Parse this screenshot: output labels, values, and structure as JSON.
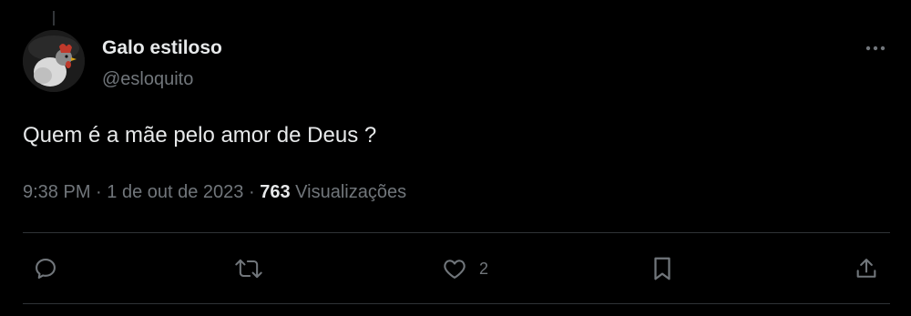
{
  "user": {
    "display_name": "Galo estiloso",
    "handle": "@esloquito",
    "avatar_icon": "rooster-avatar"
  },
  "tweet": {
    "text": "Quem é a mãe pelo amor de Deus ?",
    "time": "9:38 PM",
    "separator": "·",
    "date": "1 de out de 2023",
    "views_count": "763",
    "views_label": "Visualizações"
  },
  "actions": {
    "reply_icon": "reply-icon",
    "retweet_icon": "retweet-icon",
    "like_icon": "heart-icon",
    "like_count": "2",
    "bookmark_icon": "bookmark-icon",
    "share_icon": "share-icon",
    "more_icon": "more-icon"
  },
  "colors": {
    "background": "#000000",
    "text_primary": "#e7e9ea",
    "text_secondary": "#71767b",
    "divider": "#2f3336"
  }
}
